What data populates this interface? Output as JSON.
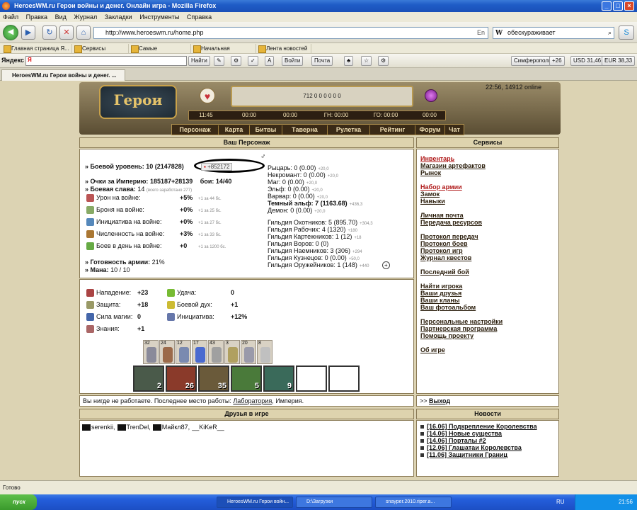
{
  "window": {
    "title": "HeroesWM.ru Герои войны и денег. Онлайн игра - Mozilla Firefox"
  },
  "menu": [
    "Файл",
    "Правка",
    "Вид",
    "Журнал",
    "Закладки",
    "Инструменты",
    "Справка"
  ],
  "navbar": {
    "url": "http://www.heroeswm.ru/home.php",
    "search_value": "обескураживает",
    "lang": "En"
  },
  "bookmarks": [
    "Главная страница Я...",
    "Сервисы Яндекса",
    "Самые популярные",
    "Начальная страница",
    "Лента новостей"
  ],
  "yandex": {
    "logo": "Яндекс",
    "find_btn": "Найти",
    "login_btn": "Войти",
    "mail_btn": "Почта",
    "city": "Симферополь",
    "temp": "+26",
    "usd": "USD 31,46",
    "eur": "EUR 38,33"
  },
  "tab": {
    "label": "HeroesWM.ru Герои войны и денег. ..."
  },
  "game": {
    "online": "22:56, 14912 online",
    "resources": "712  0  0  0  0  0  0",
    "timers": [
      "11:45",
      "00:00",
      "00:00",
      "ГН: 00:00",
      "ГО: 00:00",
      "00:00"
    ],
    "nav": [
      "Персонаж",
      "Карта",
      "Битвы",
      "Таверна",
      "Рулетка",
      "Рейтинг",
      "Форум",
      "Чат"
    ]
  },
  "character": {
    "title": "Ваш Персонаж",
    "level_label": "» Боевой уровень:",
    "level_value": "10 (2147828)",
    "exp_badge": "+852172",
    "empire_points_label": "» Очки за Империю:",
    "empire_points": "185187+28139",
    "boi": "бои: 14/40",
    "glory_label": "» Боевая слава:",
    "glory_value": "14",
    "glory_note": "(всего заработано 277)",
    "war_stats": [
      {
        "label": "Урон на войне:",
        "value": "+5%",
        "note": "+1 за 44 бс."
      },
      {
        "label": "Броня на войне:",
        "value": "+0%",
        "note": "+1 за 25 бс."
      },
      {
        "label": "Инициатива на войне:",
        "value": "+0%",
        "note": "+1 за 27 бс."
      },
      {
        "label": "Численность на войне:",
        "value": "+3%",
        "note": "+1 за 33 бс."
      },
      {
        "label": "Боев в день на войне:",
        "value": "+0",
        "note": "+1 за 1200 бс."
      }
    ],
    "army_ready_label": "» Готовность армии:",
    "army_ready_value": "21%",
    "mana_label": "» Мана:",
    "mana_value": "10 / 10",
    "guilds": [
      {
        "text": "Рыцарь: 0 (0.00)",
        "note": "+20,0"
      },
      {
        "text": "Некромант: 0 (0.00)",
        "note": "+20,0"
      },
      {
        "text": "Маг: 0 (0.00)",
        "note": "+20,0"
      },
      {
        "text": "Эльф: 0 (0.00)",
        "note": "+20,0"
      },
      {
        "text": "Варвар: 0 (0.00)",
        "note": "+20,0"
      },
      {
        "text": "Темный эльф: 7 (1163.68)",
        "note": "+436,3",
        "bold": true
      },
      {
        "text": "Демон: 0 (0.00)",
        "note": "+20,0"
      }
    ],
    "guilds2": [
      {
        "text": "Гильдия Охотников: 5 (895.70)",
        "note": "+304,3"
      },
      {
        "text": "Гильдия Рабочих: 4 (1320)",
        "note": "+180"
      },
      {
        "text": "Гильдия Картежников: 1 (12)",
        "note": "+18"
      },
      {
        "text": "Гильдия Воров: 0 (0)",
        "note": ""
      },
      {
        "text": "Гильдия Наемников: 3 (306)",
        "note": "+294"
      },
      {
        "text": "Гильдия Кузнецов: 0 (0.00)",
        "note": "+50,0"
      },
      {
        "text": "Гильдия Оружейников: 1 (148)",
        "note": "+440"
      }
    ],
    "attributes": [
      {
        "label": "Нападение:",
        "value": "+23"
      },
      {
        "label": "Защита:",
        "value": "+18"
      },
      {
        "label": "Сила магии:",
        "value": "0"
      },
      {
        "label": "Знания:",
        "value": "+1"
      }
    ],
    "attributes2": [
      {
        "label": "Удача:",
        "value": "0"
      },
      {
        "label": "Боевой дух:",
        "value": "+1"
      },
      {
        "label": "Инициатива:",
        "value": "+12%"
      }
    ],
    "artifacts": [
      "32",
      "24",
      "12",
      "17",
      "43",
      "3",
      "20",
      "8"
    ],
    "army": [
      "2",
      "26",
      "35",
      "5",
      "9",
      "",
      ""
    ],
    "work_text": "Вы нигде не работаете. Последнее место работы:",
    "work_link": "Лаборатория",
    "work_suffix": ", Империя."
  },
  "services": {
    "title": "Сервисы",
    "groups": [
      [
        {
          "label": "Инвентарь",
          "red": true
        },
        {
          "label": "Магазин артефактов"
        },
        {
          "label": "Рынок"
        }
      ],
      [
        {
          "label": "Набор армии",
          "red": true
        },
        {
          "label": "Замок"
        },
        {
          "label": "Навыки"
        }
      ],
      [
        {
          "label": "Личная почта"
        },
        {
          "label": "Передача ресурсов"
        }
      ],
      [
        {
          "label": "Протокол передач"
        },
        {
          "label": "Протокол боев"
        },
        {
          "label": "Протокол игр"
        },
        {
          "label": "Журнал квестов"
        }
      ],
      [
        {
          "label": "Последний бой"
        }
      ],
      [
        {
          "label": "Найти игрока"
        },
        {
          "label": "Ваши друзья"
        },
        {
          "label": "Ваши кланы"
        },
        {
          "label": "Ваш фотоальбом"
        }
      ],
      [
        {
          "label": "Персональные настройки"
        },
        {
          "label": "Партнерская программа"
        },
        {
          "label": "Помощь проекту"
        }
      ],
      [
        {
          "label": "Об игре"
        }
      ]
    ],
    "exit_prefix": ">> ",
    "exit": "Выход"
  },
  "friends": {
    "title": "Друзья в игре",
    "list": [
      "serenkii",
      "TrenDel",
      "Майкл87",
      "__KiKeR__"
    ]
  },
  "news": {
    "title": "Новости",
    "items": [
      "[16.06] Подкрепление Королевства",
      "[14.06] Новые существа",
      "[14.06] Порталы #2",
      "[12.06] Глашатаи Королевства",
      "[11.06] Защитники Границ"
    ]
  },
  "status": "Готово",
  "taskbar": {
    "start": "пуск",
    "tasks": [
      "HeroesWM.ru Герои войн...",
      "D:\\Загрузки",
      "snayper.2010.riper.a..."
    ],
    "lang": "RU",
    "time": "21:56"
  }
}
